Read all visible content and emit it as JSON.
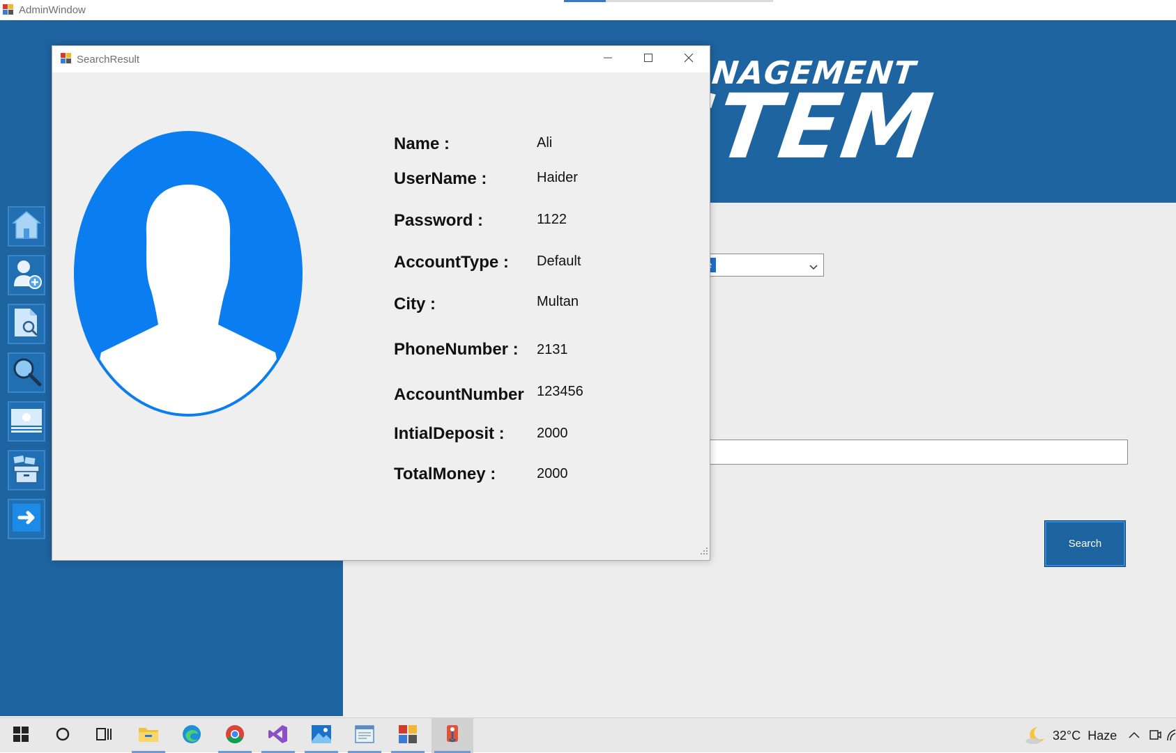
{
  "admin_window": {
    "title": "AdminWindow",
    "logo_line1": "MANAGEMENT",
    "logo_line2": "STEM",
    "account_type_select": {
      "selected_value": "e"
    },
    "search_input": {
      "value": ""
    },
    "search_button_label": "Search",
    "sidebar_icons": [
      "home-icon",
      "add-user-icon",
      "document-search-icon",
      "search-icon",
      "money-icon",
      "archive-box-icon",
      "logout-arrow-icon"
    ]
  },
  "dialog": {
    "title": "SearchResult",
    "fields": [
      {
        "label": "Name :",
        "value": "Ali"
      },
      {
        "label": "UserName :",
        "value": "Haider"
      },
      {
        "label": "Password :",
        "value": "1122"
      },
      {
        "label": "AccountType :",
        "value": "Default"
      },
      {
        "label": "City :",
        "value": "Multan"
      },
      {
        "label": "PhoneNumber :",
        "value": "2131"
      },
      {
        "label": "AccountNumber",
        "value": "123456"
      },
      {
        "label": "IntialDeposit :",
        "value": "2000"
      },
      {
        "label": "TotalMoney :",
        "value": "2000"
      }
    ]
  },
  "taskbar": {
    "apps": [
      "windows-start-icon",
      "cortana-icon",
      "task-view-icon",
      "file-explorer-icon",
      "edge-icon",
      "chrome-icon",
      "visual-studio-icon",
      "photos-icon",
      "document-app-icon",
      "winforms-app-icon",
      "paint-app-icon"
    ],
    "weather": {
      "temperature": "32°C",
      "condition": "Haze"
    }
  },
  "colors": {
    "brand_blue": "#1e64a0",
    "avatar_blue": "#0a7ef0",
    "dialog_bg": "#efefef"
  }
}
